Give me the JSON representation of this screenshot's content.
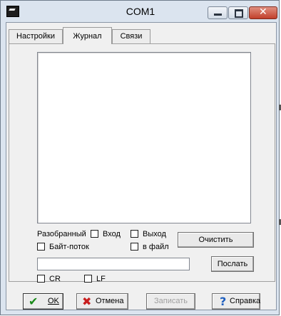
{
  "window": {
    "title": "COM1"
  },
  "tabs": [
    {
      "label": "Настройки"
    },
    {
      "label": "Журнал"
    },
    {
      "label": "Связи"
    }
  ],
  "journal": {
    "mode_label": "Разобранный",
    "checkbox_in": "Вход",
    "checkbox_out": "Выход",
    "checkbox_bytestream": "Байт-поток",
    "checkbox_tofile": "в файл",
    "clear_button": "Очистить",
    "send_input_value": "",
    "send_button": "Послать",
    "checkbox_cr": "CR",
    "checkbox_lf": "LF"
  },
  "footer": {
    "ok": "OK",
    "cancel": "Отмена",
    "write": "Записать",
    "help": "Справка"
  },
  "colors": {
    "ok_icon": "#1a8a1a",
    "cancel_icon": "#c81e1e",
    "help_icon": "#1f5fbf",
    "close_button": "#c2402b"
  }
}
